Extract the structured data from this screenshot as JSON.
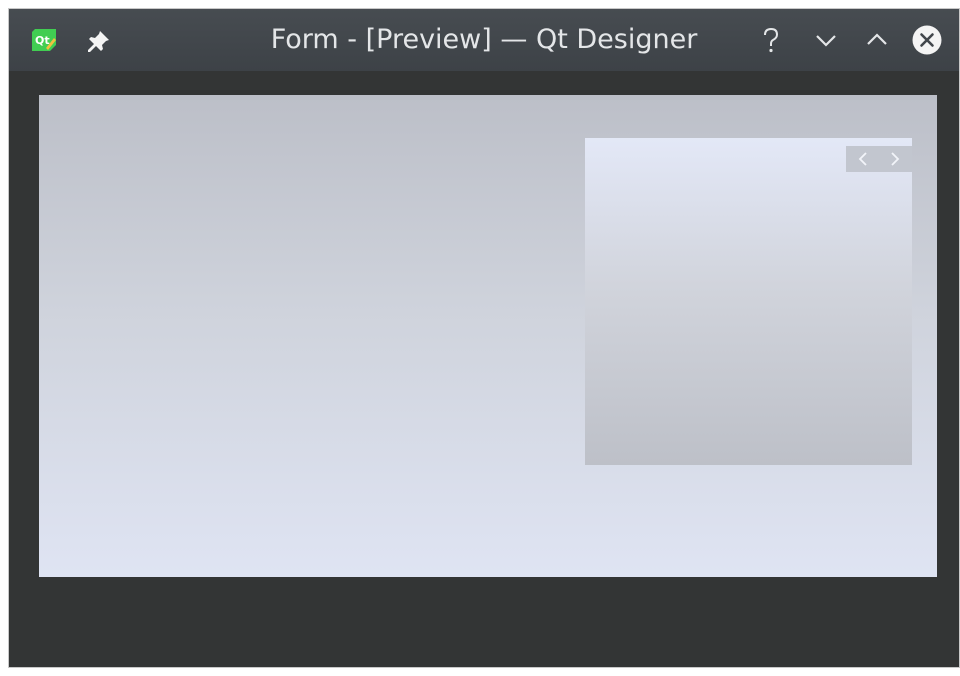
{
  "window": {
    "title": "Form - [Preview] — Qt Designer",
    "app_icon": "qt-logo",
    "pin_icon": "pin-icon",
    "buttons": [
      "help",
      "minimize",
      "maximize",
      "close"
    ]
  },
  "colors": {
    "titlebar": "#42474c",
    "window_bg": "#333535",
    "canvas_top": "#bcbfc8",
    "canvas_bottom": "#dfe4f3",
    "qt_green": "#41cd52"
  },
  "preview": {
    "nav_icons": [
      "chevron-left-icon",
      "chevron-right-icon"
    ]
  }
}
